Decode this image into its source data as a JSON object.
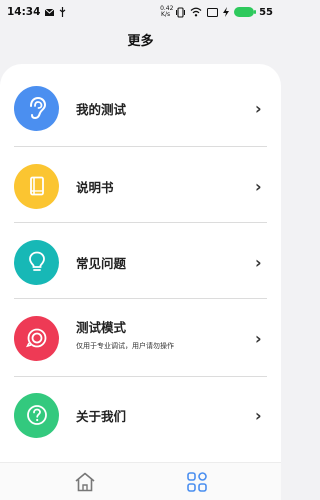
{
  "status_bar": {
    "time": "14:34",
    "net_speed_top": "0.42",
    "net_speed_bottom": "K/s",
    "battery": "55"
  },
  "header": {
    "title": "更多"
  },
  "menu": {
    "items": [
      {
        "label": "我的测试",
        "icon": "ear-icon",
        "color": "#4b8ff0"
      },
      {
        "label": "说明书",
        "icon": "book-icon",
        "color": "#fbc531"
      },
      {
        "label": "常见问题",
        "icon": "lightbulb-icon",
        "color": "#17b8b6"
      },
      {
        "label": "测试模式",
        "sublabel": "仅用于专业调试，用户请勿操作",
        "icon": "test-mode-icon",
        "color": "#ee3a55"
      },
      {
        "label": "关于我们",
        "icon": "question-icon",
        "color": "#33c97e"
      }
    ]
  },
  "tab_bar": {
    "tabs": [
      {
        "icon": "home-icon",
        "active": false
      },
      {
        "icon": "grid-icon",
        "active": true,
        "color": "#4b8ff0"
      }
    ]
  }
}
